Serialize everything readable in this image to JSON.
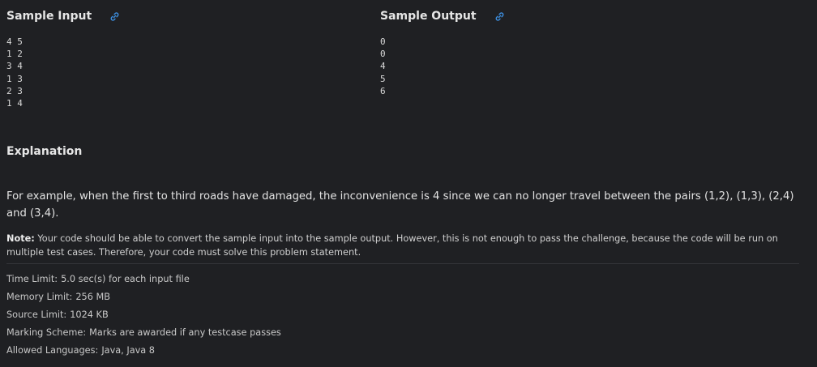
{
  "sample_input": {
    "title": "Sample Input",
    "lines": [
      "4 5",
      "1 2",
      "3 4",
      "1 3",
      "2 3",
      "1 4"
    ]
  },
  "sample_output": {
    "title": "Sample Output",
    "lines": [
      "0",
      "0",
      "4",
      "5",
      "6"
    ]
  },
  "link_icon": "link-icon",
  "accent_color": "#3d8fe0",
  "explanation": {
    "title": "Explanation",
    "text": "For example, when the first to third roads have damaged, the inconvenience is 4 since we can no longer travel between the pairs (1,2), (1,3), (2,4) and (3,4)."
  },
  "note": {
    "label": "Note:",
    "text": "Your code should be able to convert the sample input into the sample output. However, this is not enough to pass the challenge, because the code will be run on multiple test cases. Therefore, your code must solve this problem statement."
  },
  "limits": {
    "time_label": "Time Limit:",
    "time_value": "5.0 sec(s) for each input file",
    "memory_label": "Memory Limit:",
    "memory_value": "256 MB",
    "source_label": "Source Limit:",
    "source_value": "1024 KB",
    "marking_label": "Marking Scheme:",
    "marking_value": "Marks are awarded if any testcase passes",
    "languages_label": "Allowed Languages:",
    "languages_value": "Java, Java 8"
  }
}
